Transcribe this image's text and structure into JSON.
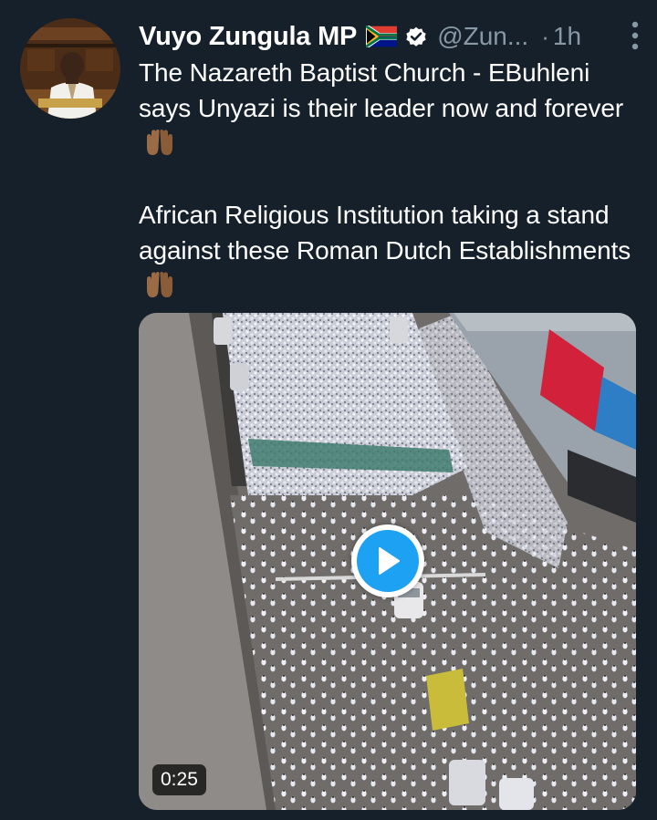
{
  "tweet": {
    "author": {
      "display_name": "Vuyo Zungula MP",
      "flag_emoji": "south-africa-flag",
      "verified": true,
      "handle": "@Zun...",
      "avatar_icon": "profile-photo-speaker-at-podium"
    },
    "separator": "·",
    "timestamp": "1h",
    "more_icon": "vertical-ellipsis-icon",
    "text": {
      "paragraph_1": "The Nazareth Baptist Church - EBuhleni says Unyazi is their leader now and forever",
      "paragraph_2": "African Religious Institution taking a stand against these Roman Dutch Establishments",
      "emoji": "raising-hands-medium-dark-skin"
    },
    "media": {
      "type": "video",
      "description_icon": "aerial-crowd-street-thumbnail",
      "duration": "0:25",
      "play_icon": "play-icon"
    }
  },
  "colors": {
    "background": "#15202b",
    "primary_text": "#ffffff",
    "secondary_text": "#8899a6",
    "accent": "#1da1f2"
  }
}
